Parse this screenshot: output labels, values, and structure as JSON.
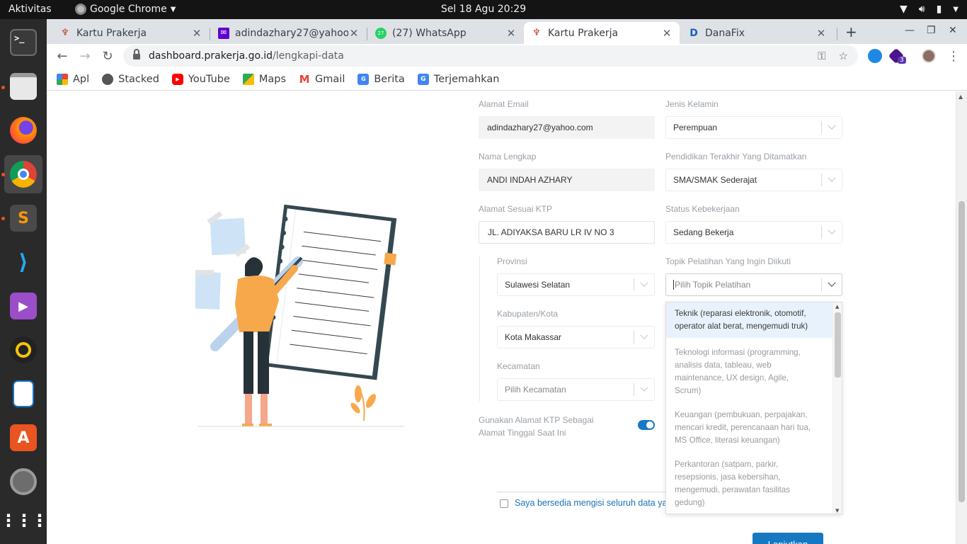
{
  "os": {
    "activities": "Aktivitas",
    "app_name": "Google Chrome",
    "clock": "Sel 18 Agu  20:29"
  },
  "browser": {
    "tabs": [
      {
        "label": "Kartu Prakerja",
        "active": false
      },
      {
        "label": "adindazhary27@yahoo",
        "active": false
      },
      {
        "label": "(27) WhatsApp",
        "active": false
      },
      {
        "label": "Kartu Prakerja",
        "active": true
      },
      {
        "label": "DanaFix",
        "active": false
      }
    ],
    "whatsapp_badge": "27",
    "url_host": "dashboard.prakerja.go.id",
    "url_path": "/lengkapi-data",
    "ext_badge": "3",
    "bookmarks": [
      "Apl",
      "Stacked",
      "YouTube",
      "Maps",
      "Gmail",
      "Berita",
      "Terjemahkan"
    ]
  },
  "form": {
    "email": {
      "label": "Alamat Email",
      "value": "adindazhary27@yahoo.com"
    },
    "gender": {
      "label": "Jenis Kelamin",
      "value": "Perempuan"
    },
    "name": {
      "label": "Nama Lengkap",
      "value": "ANDI INDAH AZHARY"
    },
    "education": {
      "label": "Pendidikan Terakhir Yang Ditamatkan",
      "value": "SMA/SMAK Sederajat"
    },
    "ktp_address": {
      "label": "Alamat Sesuai KTP",
      "value": "JL. ADIYAKSA BARU LR IV NO 3"
    },
    "employment": {
      "label": "Status Kebekerjaan",
      "value": "Sedang Bekerja"
    },
    "province": {
      "label": "Provinsi",
      "value": "Sulawesi Selatan"
    },
    "training_topic": {
      "label": "Topik Pelatihan Yang Ingin Diikuti",
      "placeholder": "Pilih Topik Pelatihan"
    },
    "city": {
      "label": "Kabupaten/Kota",
      "value": "Kota Makassar"
    },
    "district": {
      "label": "Kecamatan",
      "placeholder": "Pilih Kecamatan"
    },
    "use_ktp_toggle": {
      "label_line1": "Gunakan Alamat KTP Sebagai",
      "label_line2": "Alamat Tinggal Saat Ini",
      "on": true
    },
    "agree_text": "Saya bersedia mengisi seluruh data ya",
    "submit_label": "Lanjutkan"
  },
  "topic_options": [
    {
      "lines": [
        "Teknik (reparasi elektronik, otomotif,",
        "operator alat berat, mengemudi truk)"
      ],
      "highlighted": true
    },
    {
      "lines": [
        "Teknologi informasi (programming,",
        "analisis data, tableau, web",
        "maintenance, UX design, Agile,",
        "Scrum)"
      ],
      "highlighted": false
    },
    {
      "lines": [
        "Keuangan (pembukuan, perpajakan,",
        "mencari kredit, perencanaan hari tua,",
        "MS Office, literasi keuangan)"
      ],
      "highlighted": false
    },
    {
      "lines": [
        "Perkantoran (satpam, parkir,",
        "resepsionis, jasa kebersihan,",
        "mengemudi, perawatan fasilitas",
        "gedung)"
      ],
      "highlighted": false
    }
  ],
  "colors": {
    "accent": "#1778c2",
    "toggle": "#1779c8",
    "dropdown_highlight": "#e8f2fc",
    "illustration_orange": "#f7a84b"
  }
}
